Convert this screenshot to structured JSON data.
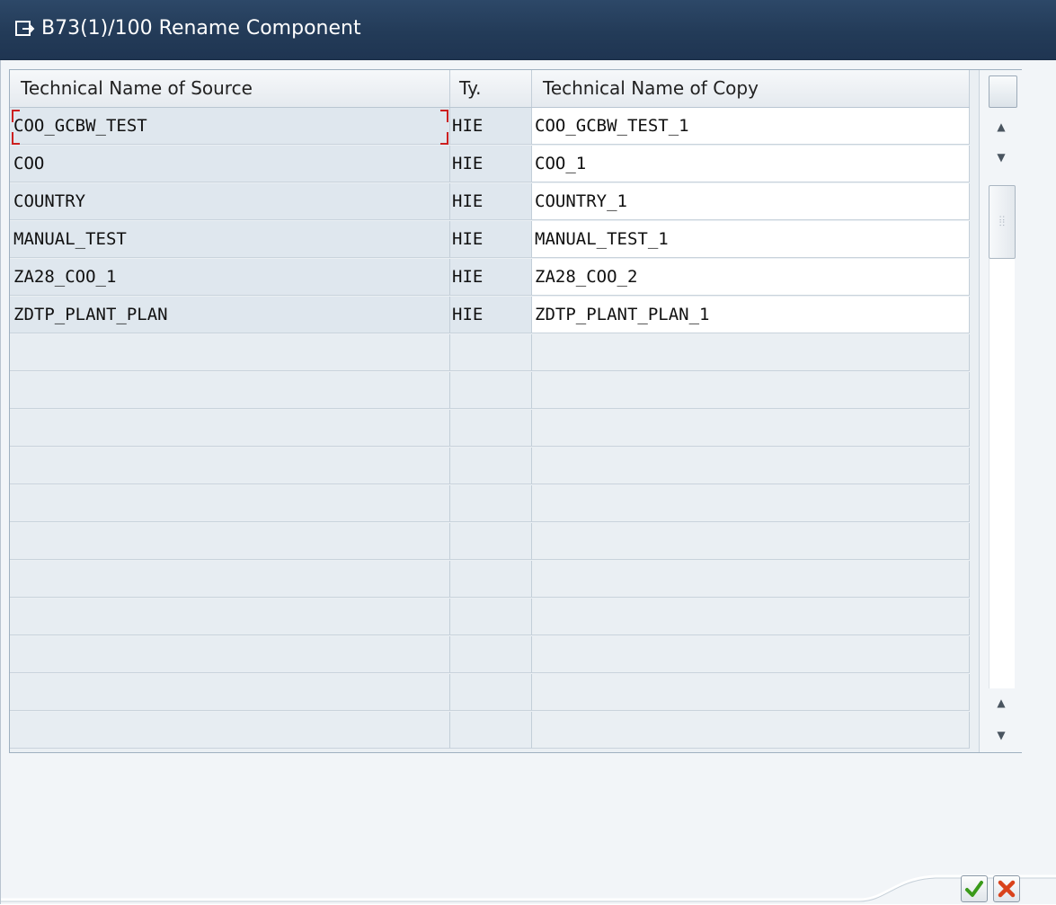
{
  "window": {
    "title": "B73(1)/100 Rename Component"
  },
  "table": {
    "columns": {
      "source": "Technical Name of Source",
      "type": "Ty.",
      "copy": "Technical Name of Copy"
    },
    "rows": [
      {
        "source": "COO_GCBW_TEST",
        "type": "HIE",
        "copy": "COO_GCBW_TEST_1"
      },
      {
        "source": "COO",
        "type": "HIE",
        "copy": "COO_1"
      },
      {
        "source": "COUNTRY",
        "type": "HIE",
        "copy": "COUNTRY_1"
      },
      {
        "source": "MANUAL_TEST",
        "type": "HIE",
        "copy": "MANUAL_TEST_1"
      },
      {
        "source": "ZA28_COO_1",
        "type": "HIE",
        "copy": "ZA28_COO_2"
      },
      {
        "source": "ZDTP_PLANT_PLAN",
        "type": "HIE",
        "copy": "ZDTP_PLANT_PLAN_1"
      }
    ],
    "empty_rows": 11,
    "focused_row": 0
  },
  "colors": {
    "titlebar": "#233b58",
    "focus": "#cc2020",
    "ok_icon": "#3a9a1a",
    "cancel_icon": "#d9421b"
  },
  "icons": {
    "title": "dialog-icon",
    "ok": "check-icon",
    "cancel": "cancel-icon",
    "column_settings": "column-settings-icon"
  }
}
